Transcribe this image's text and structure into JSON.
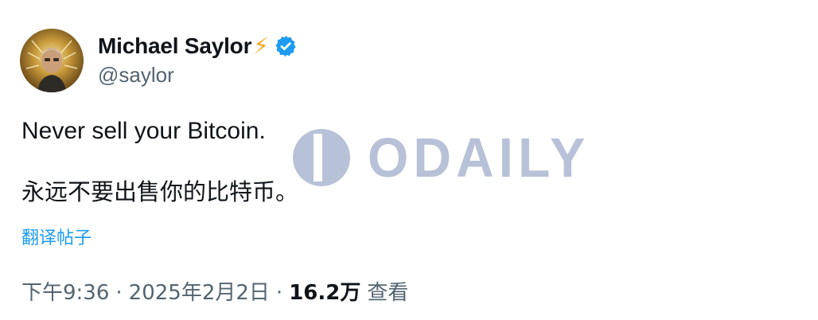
{
  "author": {
    "name": "Michael Saylor",
    "name_emoji": "⚡",
    "handle": "@saylor",
    "verified": true
  },
  "tweet": {
    "text_en": "Never sell your Bitcoin.",
    "text_zh": "永远不要出售你的比特币。",
    "translate_label": "翻译帖子"
  },
  "meta": {
    "time": "下午9:36",
    "separator": "·",
    "date": "2025年2月2日",
    "views_count": "16.2万",
    "views_label": "查看"
  },
  "watermark": {
    "text": "ODAILY"
  },
  "colors": {
    "text_primary": "#0f1419",
    "text_secondary": "#536471",
    "link": "#1d9bf0",
    "verified": "#1d9bf0",
    "watermark": "#7d8fb8"
  }
}
